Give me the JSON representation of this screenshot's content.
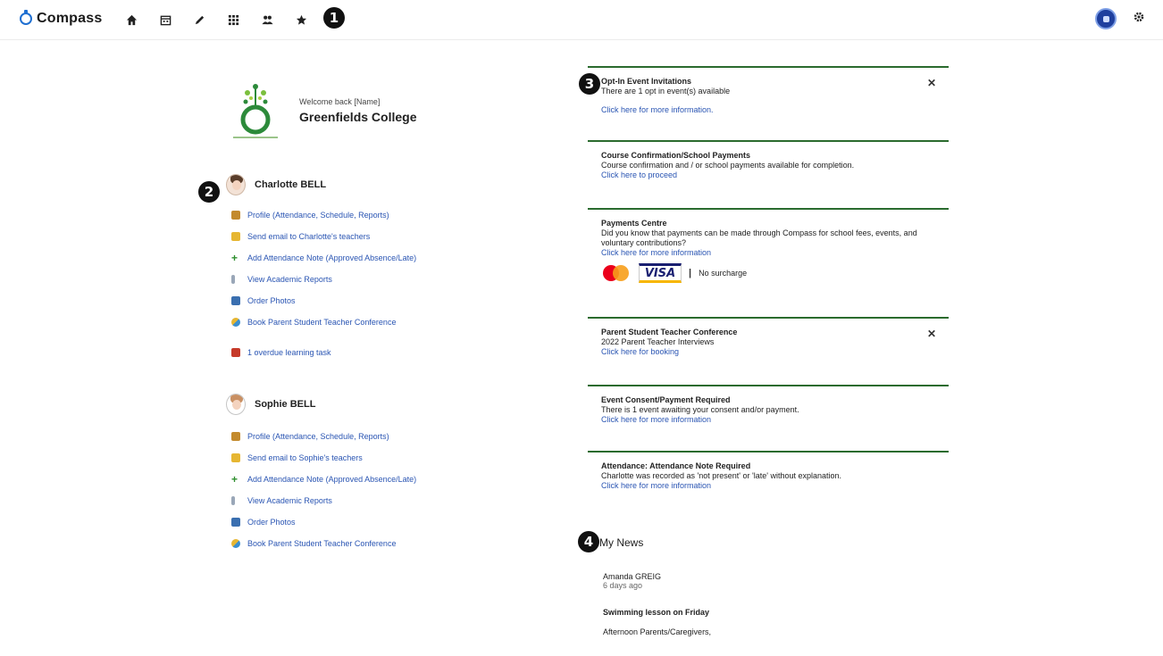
{
  "app": {
    "name": "Compass"
  },
  "nav_icons": [
    "home-icon",
    "calendar-icon",
    "pencil-icon",
    "apps-grid-icon",
    "people-icon",
    "star-icon"
  ],
  "callouts": {
    "c1": "1",
    "c2": "2",
    "c3": "3",
    "c4": "4"
  },
  "colors": {
    "accent": "#1f6fd1",
    "link": "#2a55b3",
    "card_border": "#2a6b2e",
    "avatar": "#1f3f9e"
  },
  "school": {
    "welcome": "Welcome back [Name]",
    "name": "Greenfields College"
  },
  "students": [
    {
      "name": "Charlotte BELL",
      "actions": [
        {
          "label": "Profile (Attendance, Schedule, Reports)",
          "icon": "profile-icon"
        },
        {
          "label": "Send email to Charlotte's teachers",
          "icon": "email-icon"
        },
        {
          "label": "Add Attendance Note (Approved Absence/Late)",
          "icon": "plus-icon"
        },
        {
          "label": "View Academic Reports",
          "icon": "report-icon"
        },
        {
          "label": "Order Photos",
          "icon": "photo-icon"
        },
        {
          "label": "Book Parent Student Teacher Conference",
          "icon": "conference-icon"
        },
        {
          "label": "1 overdue learning task",
          "icon": "task-icon"
        }
      ]
    },
    {
      "name": "Sophie BELL",
      "actions": [
        {
          "label": "Profile (Attendance, Schedule, Reports)",
          "icon": "profile-icon"
        },
        {
          "label": "Send email to Sophie's teachers",
          "icon": "email-icon"
        },
        {
          "label": "Add Attendance Note (Approved Absence/Late)",
          "icon": "plus-icon"
        },
        {
          "label": "View Academic Reports",
          "icon": "report-icon"
        },
        {
          "label": "Order Photos",
          "icon": "photo-icon"
        },
        {
          "label": "Book Parent Student Teacher Conference",
          "icon": "conference-icon"
        }
      ]
    }
  ],
  "cards": [
    {
      "title": "Opt-In Event Invitations",
      "text": "There are 1 opt in event(s) available",
      "link": "Click here for more information.",
      "closable": true
    },
    {
      "title": "Course Confirmation/School Payments",
      "text": "Course confirmation and / or school payments available for completion.",
      "link": "Click here to proceed",
      "closable": false
    },
    {
      "title": "Payments Centre",
      "text": "Did you know that payments can be made through Compass for school fees, events, and voluntary contributions?",
      "link": "Click here for more information",
      "closable": false,
      "payment": {
        "visa": "VISA",
        "separator": "|",
        "surcharge": "No surcharge"
      }
    },
    {
      "title": "Parent Student Teacher Conference",
      "text": "2022 Parent Teacher Interviews",
      "link": "Click here for booking",
      "closable": true
    },
    {
      "title": "Event Consent/Payment Required",
      "text": "There is 1 event awaiting your consent and/or payment.",
      "link": "Click here for more information",
      "closable": false
    },
    {
      "title": "Attendance: Attendance Note Required",
      "text": "Charlotte was recorded as 'not present' or 'late' without explanation.",
      "link": "Click here for more information",
      "closable": false
    }
  ],
  "news": {
    "title": "My News",
    "author": "Amanda GREIG",
    "age": "6 days ago",
    "headline": "Swimming lesson on Friday",
    "salutation": "Afternoon Parents/Caregivers,"
  }
}
